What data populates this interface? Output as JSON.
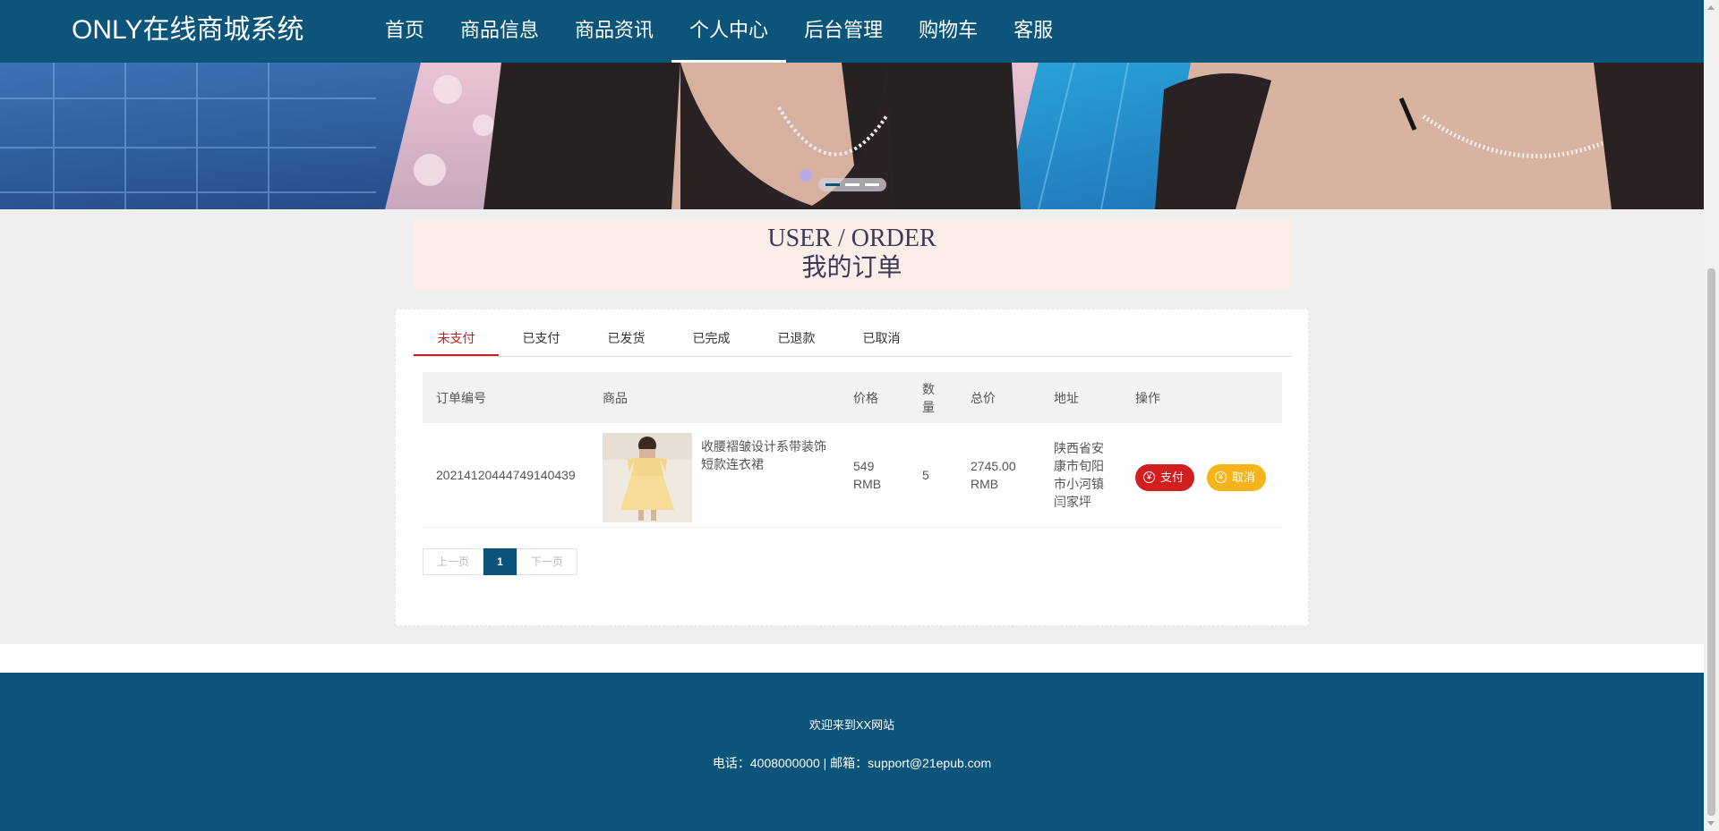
{
  "header": {
    "brand": "ONLY在线商城系统",
    "nav": [
      {
        "label": "首页"
      },
      {
        "label": "商品信息"
      },
      {
        "label": "商品资讯"
      },
      {
        "label": "个人中心",
        "active": true
      },
      {
        "label": "后台管理"
      },
      {
        "label": "购物车"
      },
      {
        "label": "客服"
      }
    ]
  },
  "banner": {
    "slide_count": 3,
    "active_slide": 1
  },
  "section": {
    "title_en": "USER / ORDER",
    "title_cn": "我的订单"
  },
  "tabs": [
    {
      "label": "未支付",
      "active": true
    },
    {
      "label": "已支付"
    },
    {
      "label": "已发货"
    },
    {
      "label": "已完成"
    },
    {
      "label": "已退款"
    },
    {
      "label": "已取消"
    }
  ],
  "table": {
    "headers": {
      "order_no": "订单编号",
      "product": "商品",
      "price": "价格",
      "qty": "数量",
      "total": "总价",
      "address": "地址",
      "action": "操作"
    },
    "rows": [
      {
        "order_no": "20214120444749140439",
        "product_name": "收腰褶皱设计系带装饰短款连衣裙",
        "price": "549 RMB",
        "qty": "5",
        "total": "2745.00 RMB",
        "address": "陕西省安康市旬阳市小河镇闫家坪",
        "pay_label": "支付",
        "cancel_label": "取消"
      }
    ]
  },
  "pagination": {
    "prev": "上一页",
    "current": "1",
    "next": "下一页"
  },
  "footer": {
    "welcome": "欢迎来到XX网站",
    "contact": "电话：4008000000 | 邮箱：support@21epub.com"
  },
  "colors": {
    "primary": "#0c5479",
    "active_tab": "#c81e1e",
    "pay_button": "#d11f1f",
    "cancel_button": "#f6b41a",
    "title_background": "#fbeee8"
  }
}
